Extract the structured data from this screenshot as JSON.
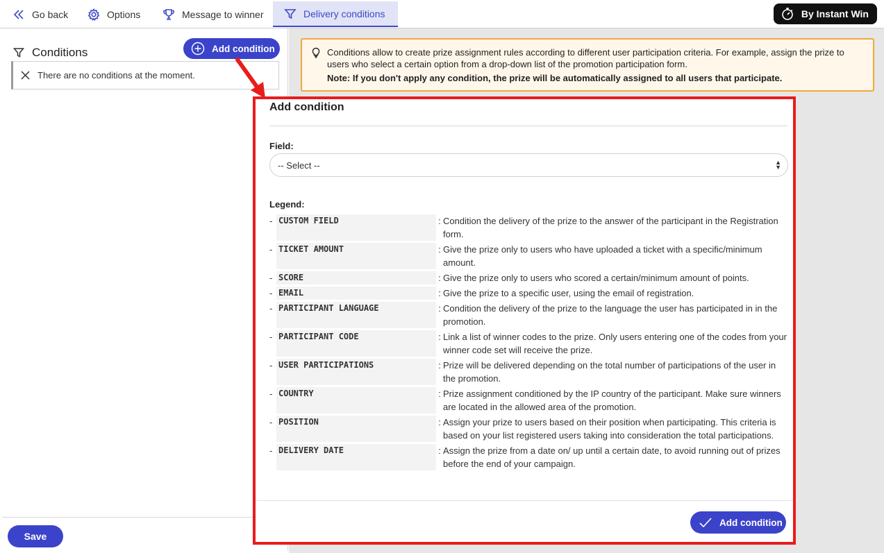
{
  "topnav": {
    "go_back": "Go back",
    "options": "Options",
    "message_to_winner": "Message to winner",
    "delivery_conditions": "Delivery conditions",
    "brand": "By Instant Win"
  },
  "left": {
    "title": "Conditions",
    "add_button": "Add condition",
    "empty_message": "There are no conditions at the moment.",
    "save_button": "Save"
  },
  "notice": {
    "text": "Conditions allow to create prize assignment rules according to different user participation criteria. For example, assign the prize to users who select a certain option from a drop-down list of the promotion participation form.",
    "note": "Note: If you don't apply any condition, the prize will be automatically assigned to all users that participate."
  },
  "modal": {
    "title": "Add condition",
    "field_label": "Field:",
    "select_value": "-- Select --",
    "legend_label": "Legend:",
    "submit_button": "Add condition",
    "legend": [
      {
        "key": "CUSTOM FIELD",
        "desc": "Condition the delivery of the prize to the answer of the participant in the Registration form."
      },
      {
        "key": "TICKET AMOUNT",
        "desc": "Give the prize only to users who have uploaded a ticket with a specific/minimum amount."
      },
      {
        "key": "SCORE",
        "desc": "Give the prize only to users who scored a certain/minimum amount of points."
      },
      {
        "key": "EMAIL",
        "desc": "Give the prize to a specific user, using the email of registration."
      },
      {
        "key": "PARTICIPANT LANGUAGE",
        "desc": "Condition the delivery of the prize to the language the user has participated in in the promotion."
      },
      {
        "key": "PARTICIPANT CODE",
        "desc": "Link a list of winner codes to the prize. Only users entering one of the codes from your winner code set will receive the prize."
      },
      {
        "key": "USER PARTICIPATIONS",
        "desc": "Prize will be delivered depending on the total number of participations of the user in the promotion."
      },
      {
        "key": "COUNTRY",
        "desc": "Prize assignment conditioned by the IP country of the participant. Make sure winners are located in the allowed area of the promotion."
      },
      {
        "key": "POSITION",
        "desc": "Assign your prize to users based on their position when participating. This criteria is based on your list registered users taking into consideration the total participations."
      },
      {
        "key": "DELIVERY DATE",
        "desc": "Assign the prize from a date on/ up until a certain date, to avoid running out of prizes before the end of your campaign."
      }
    ]
  },
  "colors": {
    "accent": "#3a43c9",
    "highlight_frame": "#e91c1c",
    "notice_border": "#f0a83a",
    "notice_bg": "#fff7ea"
  }
}
